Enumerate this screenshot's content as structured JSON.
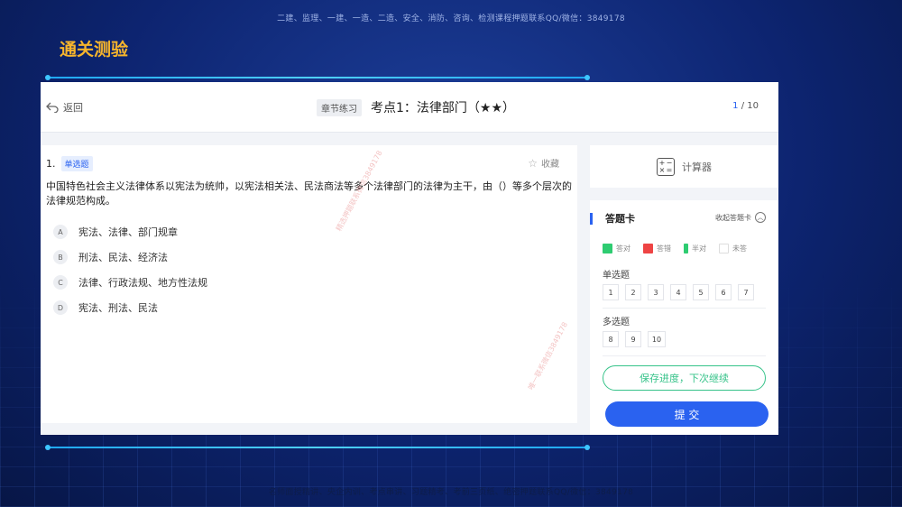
{
  "top_banner": "二建、监理、一建、一造、二造、安全、消防、咨询、检测课程押题联系QQ/微信：3849178",
  "bottom_banner": "名师面授精讲、央企内训、考点串讲、习题精考、考前三页纸、绝密押题联系QQ/微信：3849178",
  "page_heading": "通关测验",
  "header": {
    "back_label": "返回",
    "chapter_tag": "章节练习",
    "section_title": "考点1：法律部门（★★）",
    "pager_current": "1",
    "pager_total": " / 10"
  },
  "question": {
    "number": "1.",
    "type": "单选题",
    "favorite_label": "收藏",
    "text": "中国特色社会主义法律体系以宪法为统帅，以宪法相关法、民法商法等多个法律部门的法律为主干，由（）等多个层次的法律规范构成。",
    "options": [
      {
        "letter": "A",
        "text": "宪法、法律、部门规章"
      },
      {
        "letter": "B",
        "text": "刑法、民法、经济法"
      },
      {
        "letter": "C",
        "text": "法律、行政法规、地方性法规"
      },
      {
        "letter": "D",
        "text": "宪法、刑法、民法"
      }
    ]
  },
  "calculator": {
    "label": "计算器",
    "icon_glyphs": [
      "+",
      "−",
      "×",
      "="
    ]
  },
  "answer_card": {
    "title": "答题卡",
    "collapse_label": "收起答题卡",
    "legend": [
      {
        "label": "答对",
        "color": "#2ecc71"
      },
      {
        "label": "答错",
        "color": "#ee4444"
      },
      {
        "label": "半对",
        "color": "#2ecc71"
      },
      {
        "label": "未答",
        "color": "#ffffff"
      }
    ],
    "single_choice_label": "单选题",
    "single_choice_numbers": [
      "1",
      "2",
      "3",
      "4",
      "5",
      "6",
      "7"
    ],
    "multi_choice_label": "多选题",
    "multi_choice_numbers": [
      "8",
      "9",
      "10"
    ],
    "save_label": "保存进度，下次继续",
    "submit_label": "提 交"
  },
  "watermarks": [
    "精选押题联系微信3849178",
    "唯一联系微信3849178"
  ],
  "colors": {
    "accent": "#2a62f0",
    "heading": "#f7b52c",
    "save": "#37c38a"
  }
}
